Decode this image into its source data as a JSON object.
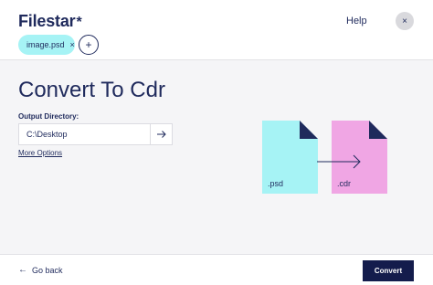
{
  "header": {
    "logo_text": "Filestar",
    "logo_mark": "*",
    "help_label": "Help",
    "close_label": "×",
    "file_chip": {
      "name": "image.psd",
      "remove_label": "×"
    },
    "add_label": "+"
  },
  "main": {
    "title": "Convert To Cdr",
    "output_label": "Output Directory:",
    "output_value": "C:\\Desktop",
    "more_options_label": "More Options"
  },
  "illustration": {
    "source_label": ".psd",
    "target_label": ".cdr",
    "source_color": "#a6f3f5",
    "target_color": "#f0a6e4",
    "corner_color": "#1f2a5c"
  },
  "footer": {
    "back_label": "Go back",
    "back_icon": "←",
    "convert_label": "Convert"
  },
  "colors": {
    "navy": "#1f2a5c",
    "button": "#141c4c",
    "chip": "#a6f3f5"
  }
}
